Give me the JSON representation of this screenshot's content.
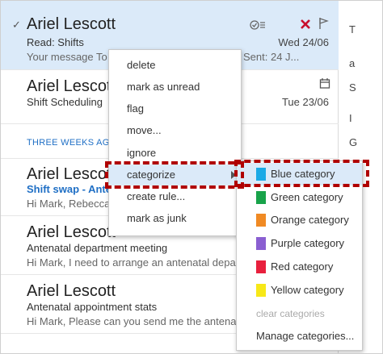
{
  "messages": [
    {
      "sender": "Ariel Lescott",
      "subject": "Read: Shifts",
      "preview": "Your message To",
      "preview_tail": "Sent: 24 J...",
      "date": "Wed 24/06",
      "selected": true,
      "icons": [
        "check-mark-icon",
        "read-receipt-icon",
        "delete-icon",
        "flag-icon"
      ]
    },
    {
      "sender": "Ariel Lescott",
      "subject": "Shift Scheduling",
      "preview": "",
      "date": "Tue 23/06",
      "icons": [
        "calendar-icon"
      ]
    },
    {
      "sender": "Ariel Lescott",
      "subject": "Shift swap - Ante",
      "preview": "Hi Mark, Rebecca"
    },
    {
      "sender": "Ariel Lescott",
      "subject": "Antenatal department meeting",
      "preview": "Hi Mark, I need to arrange an antenatal depa"
    },
    {
      "sender": "Ariel Lescott",
      "subject": "Antenatal appointment stats",
      "preview": "Hi Mark, Please can you send me the antenatal"
    }
  ],
  "group_label": "THREE WEEKS AGO",
  "right_strip": [
    "T",
    "a",
    "S",
    "I",
    "G"
  ],
  "context_menu": {
    "items": [
      "delete",
      "mark as unread",
      "flag",
      "move...",
      "ignore",
      "categorize",
      "create rule...",
      "mark as junk"
    ],
    "highlighted": "categorize"
  },
  "submenu": {
    "items": [
      {
        "label": "Blue category",
        "color": "#1aa9e6"
      },
      {
        "label": "Green category",
        "color": "#18a34a"
      },
      {
        "label": "Orange category",
        "color": "#f08a24"
      },
      {
        "label": "Purple category",
        "color": "#8a5fd1"
      },
      {
        "label": "Red category",
        "color": "#e8203d"
      },
      {
        "label": "Yellow category",
        "color": "#f7e818"
      }
    ],
    "clear_label": "clear categories",
    "manage_label": "Manage categories..."
  },
  "colors": {
    "selected_bg": "#dbeaf9",
    "accent": "#1f6fc5",
    "highlight_box": "#b00000",
    "delete": "#c8102e"
  }
}
